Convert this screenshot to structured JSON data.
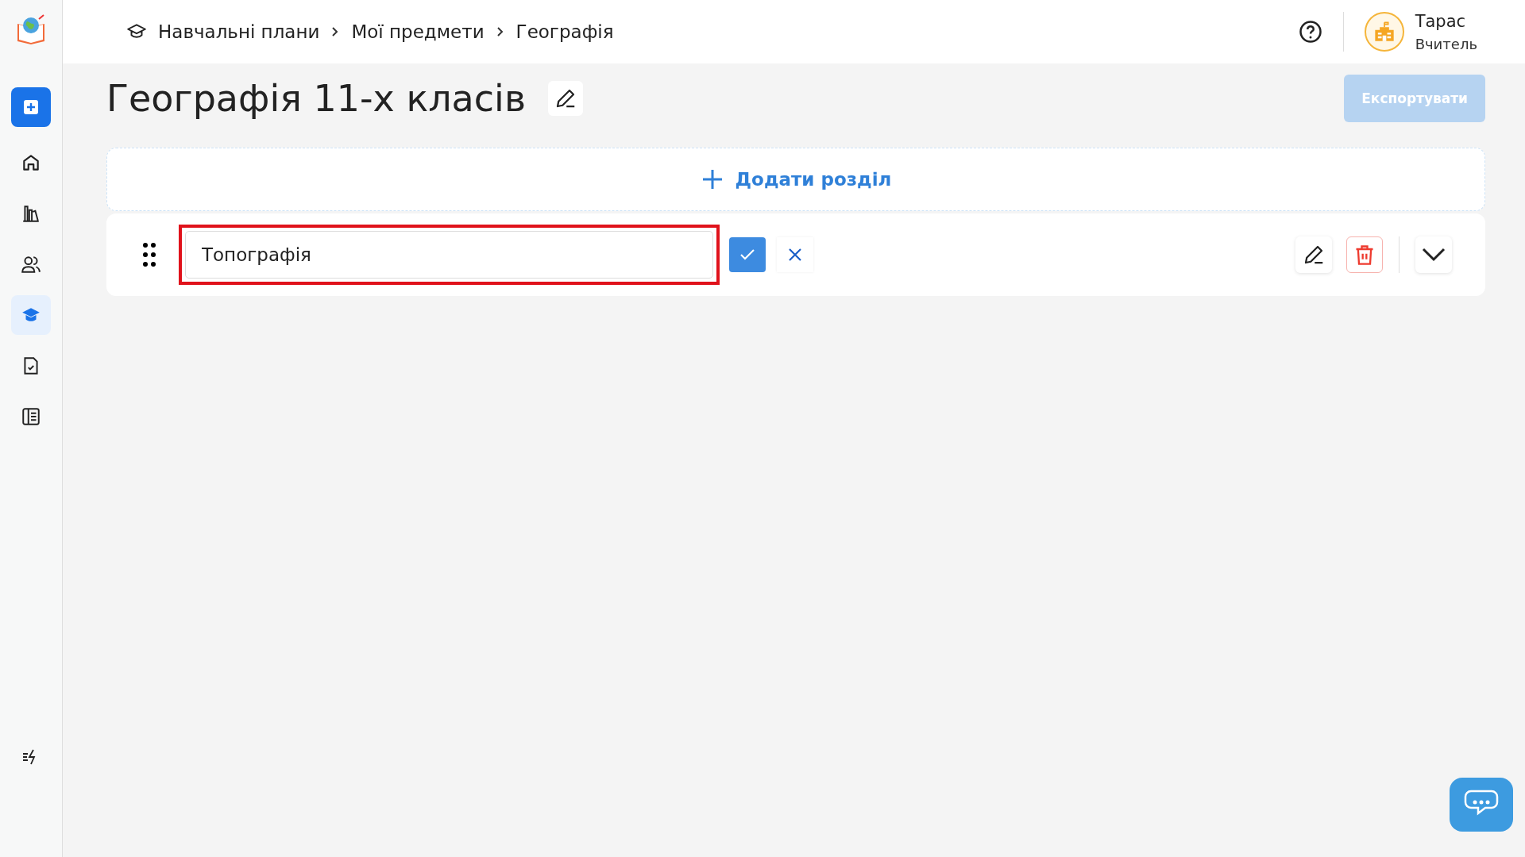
{
  "sidebar": {
    "items": [
      {
        "kind": "home",
        "selected": false
      },
      {
        "kind": "library",
        "selected": false
      },
      {
        "kind": "users",
        "selected": false
      },
      {
        "kind": "cap",
        "selected": true
      },
      {
        "kind": "doc",
        "selected": false
      },
      {
        "kind": "journal",
        "selected": false
      }
    ]
  },
  "breadcrumbs": [
    "Навчальні плани",
    "Мої предмети",
    "Географія"
  ],
  "user": {
    "name": "Тарас",
    "role": "Вчитель"
  },
  "title": "Географія 11-х класів",
  "export_button": {
    "label": "Експортувати",
    "disabled": true
  },
  "add_section": {
    "label": "Додати розділ"
  },
  "sections": [
    {
      "value": "Топографія",
      "editing": true
    }
  ]
}
